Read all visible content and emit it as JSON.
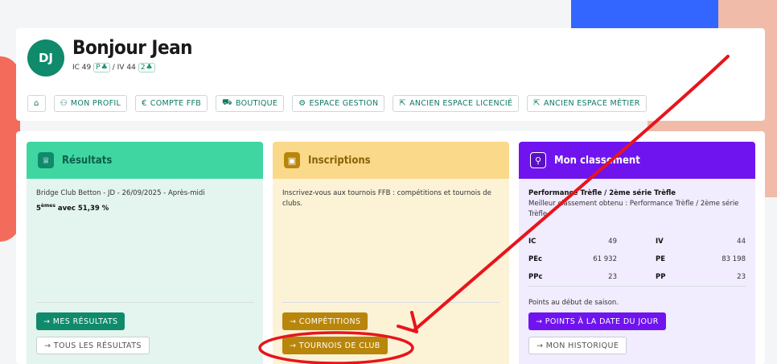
{
  "header": {
    "avatar_initials": "DJ",
    "greeting": "Bonjour Jean",
    "ic_text": "IC 49",
    "ic_badge": "P",
    "iv_text": "/ IV 44",
    "iv_badge": "2"
  },
  "nav": [
    {
      "icon": "home-icon",
      "label": ""
    },
    {
      "icon": "users-icon",
      "label": "MON PROFIL"
    },
    {
      "icon": "euro-icon",
      "label": "COMPTE FFB"
    },
    {
      "icon": "cart-icon",
      "label": "BOUTIQUE"
    },
    {
      "icon": "gear-icon",
      "label": "ESPACE GESTION"
    },
    {
      "icon": "external-link-icon",
      "label": "ANCIEN ESPACE LICENCIÉ"
    },
    {
      "icon": "external-link-icon",
      "label": "ANCIEN ESPACE MÉTIER"
    }
  ],
  "resultats": {
    "title": "Résultats",
    "event": "Bridge Club Betton - JD - 26/09/2025 - Après-midi",
    "rank": "5",
    "rank_sup": "èmes",
    "rank_rest": " avec 51,39 %",
    "btn_primary": "→ MES RÉSULTATS",
    "btn_secondary": "→ TOUS LES RÉSULTATS"
  },
  "inscriptions": {
    "title": "Inscriptions",
    "text": "Inscrivez-vous aux tournois FFB : compétitions et tournois de clubs.",
    "btn_1": "→ COMPÉTITIONS",
    "btn_2": "→ TOURNOIS DE CLUB"
  },
  "classement": {
    "title": "Mon classement",
    "perf_title": "Performance Trèfle / 2ème série Trèfle",
    "perf_sub": "Meilleur classement obtenu : Performance Trèfle / 2ème série Trèfle",
    "stats": [
      {
        "l1": "IC",
        "v1": "49",
        "l2": "IV",
        "v2": "44"
      },
      {
        "l1": "PEc",
        "v1": "61 932",
        "l2": "PE",
        "v2": "83 198"
      },
      {
        "l1": "PPc",
        "v1": "23",
        "l2": "PP",
        "v2": "23"
      }
    ],
    "season_text": "Points au début de saison.",
    "btn_primary": "→ POINTS À LA DATE DU JOUR",
    "btn_secondary": "→ MON HISTORIQUE"
  },
  "annotation": {
    "color": "#e8141c"
  }
}
